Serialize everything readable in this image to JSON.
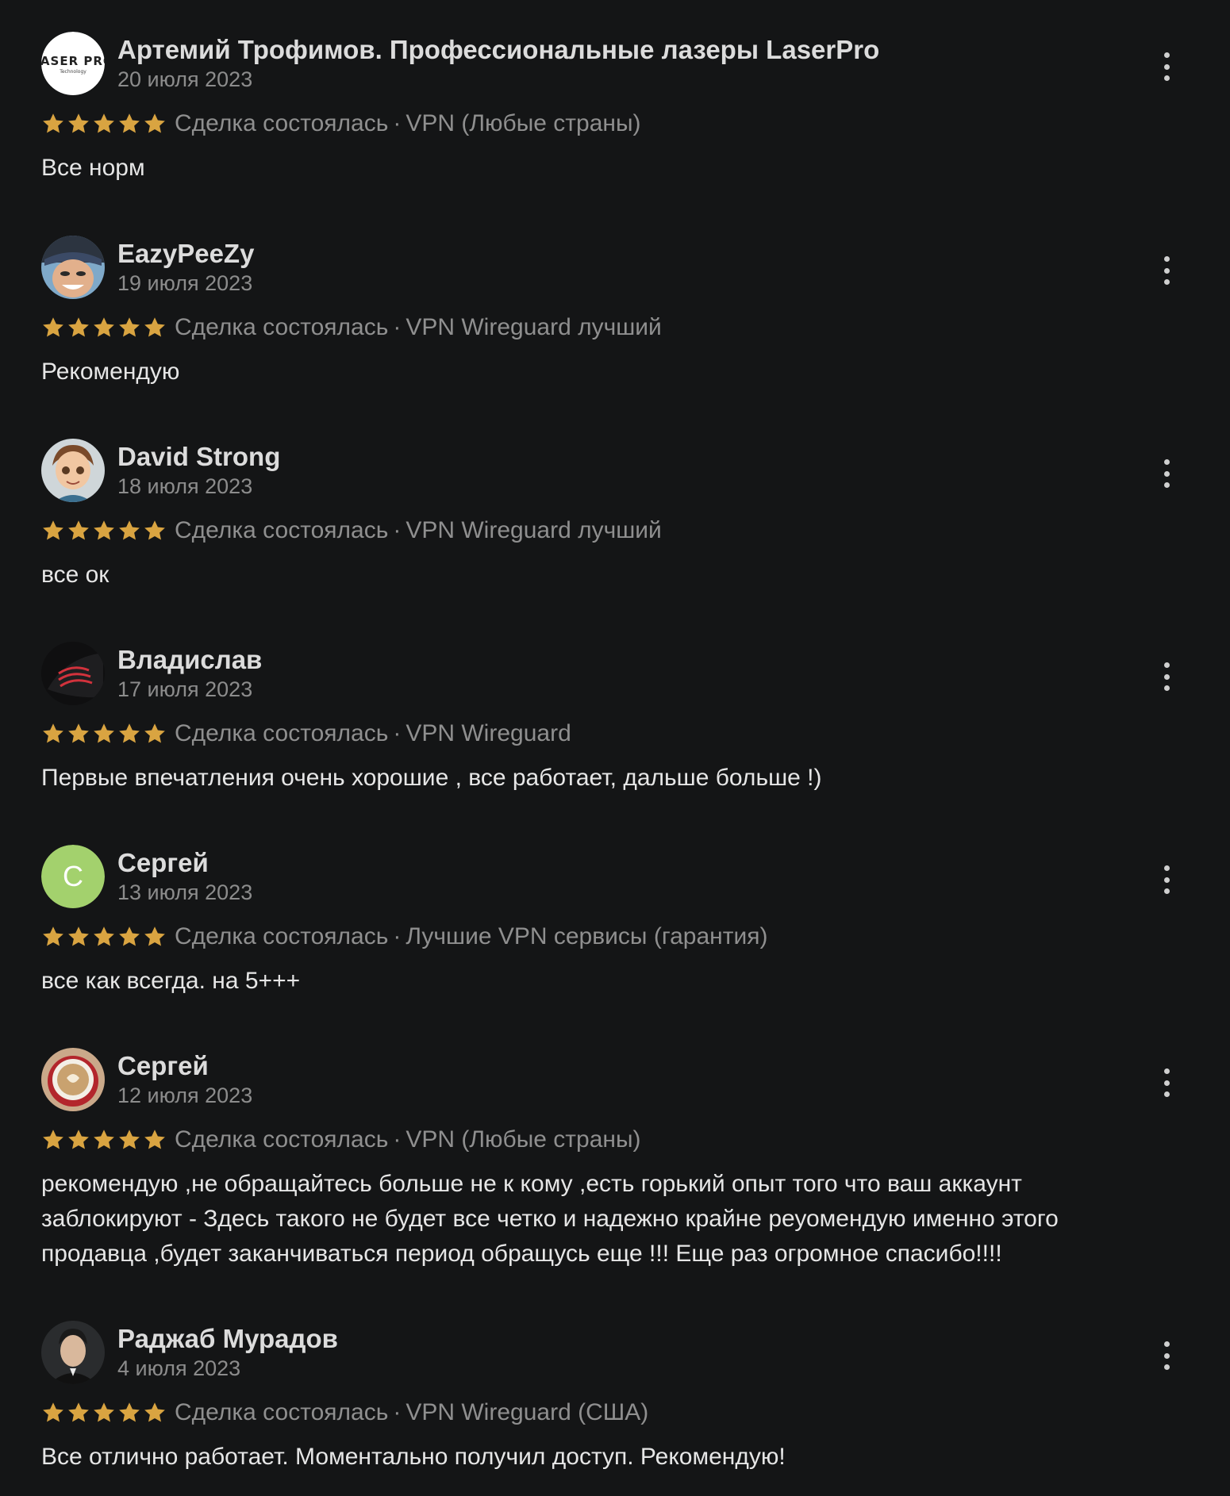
{
  "colors": {
    "background": "#141516",
    "star": "#d9a441",
    "muted": "#8c8c8c",
    "text": "#e6e6e6"
  },
  "status_separator": "·",
  "reviews": [
    {
      "author": "Артемий Трофимов. Профессиональные лазеры LaserPro",
      "date": "20 июля 2023",
      "rating": 5,
      "status": "Сделка состоялась",
      "product": "VPN (Любые страны)",
      "text": "Все норм",
      "avatar": {
        "type": "logo",
        "logo_text": "LASER PRO",
        "logo_subtext": "Technology"
      }
    },
    {
      "author": "EazyPeeZy",
      "date": "19 июля 2023",
      "rating": 5,
      "status": "Сделка состоялась",
      "product": "VPN Wireguard лучший",
      "text": "Рекомендую",
      "avatar": {
        "type": "photo",
        "icon": "person-cap-photo"
      }
    },
    {
      "author": "David Strong",
      "date": "18 июля 2023",
      "rating": 5,
      "status": "Сделка состоялась",
      "product": "VPN Wireguard лучший",
      "text": "все ок",
      "avatar": {
        "type": "photo",
        "icon": "cartoon-boy-photo"
      }
    },
    {
      "author": "Владислав",
      "date": "17 июля 2023",
      "rating": 5,
      "status": "Сделка состоялась",
      "product": "VPN Wireguard",
      "text": "Первые впечатления очень хорошие , все работает, дальше больше !)",
      "avatar": {
        "type": "photo",
        "icon": "car-light-photo"
      }
    },
    {
      "author": "Сергей",
      "date": "13 июля 2023",
      "rating": 5,
      "status": "Сделка состоялась",
      "product": "Лучшие VPN сервисы (гарантия)",
      "text": "все как всегда. на 5+++",
      "avatar": {
        "type": "letter",
        "letter": "С",
        "color": "#a3d16d"
      }
    },
    {
      "author": "Сергей",
      "date": "12 июля 2023",
      "rating": 5,
      "status": "Сделка состоялась",
      "product": "VPN (Любые страны)",
      "text": "рекомендую ,не обращайтесь больше не к кому ,есть горький опыт того что ваш аккаунт заблокируют - Здесь такого не будет все четко и надежно крайне реуомендую именно этого продавца ,будет заканчиваться период обращусь еще !!! Еще раз огромное спасибо!!!!",
      "avatar": {
        "type": "photo",
        "icon": "coffee-cup-photo"
      }
    },
    {
      "author": "Раджаб Мурадов",
      "date": "4 июля 2023",
      "rating": 5,
      "status": "Сделка состоялась",
      "product": "VPN Wireguard (США)",
      "text": "Все отлично работает. Моментально получил доступ. Рекомендую!",
      "avatar": {
        "type": "photo",
        "icon": "man-portrait-photo"
      }
    }
  ]
}
